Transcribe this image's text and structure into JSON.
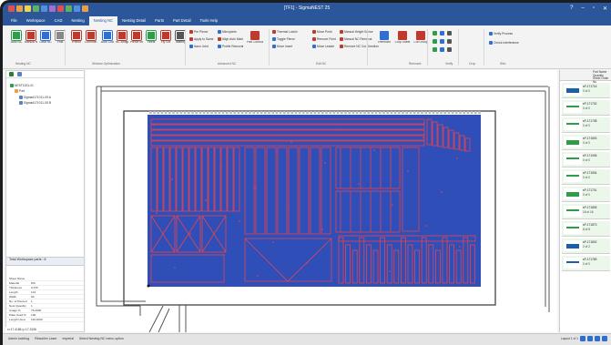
{
  "window": {
    "title": "[TF1] - SigmaNEST 25"
  },
  "tabs": [
    "File",
    "Workspace",
    "CAD",
    "Nesting",
    "Nesting NC",
    "Nesting Detail",
    "Parts",
    "Part Detail",
    "Tools Help"
  ],
  "active_tab": "Nesting NC",
  "ribbon": {
    "buttons": [
      {
        "label": "Auto NC"
      },
      {
        "label": "Manual NC"
      },
      {
        "label": "Clear NC"
      },
      {
        "label": "Post"
      },
      {
        "label": "iPierce"
      },
      {
        "label": "Common Cut"
      },
      {
        "label": "Auto Chain"
      },
      {
        "label": "NC Bridge"
      },
      {
        "label": "Pierce Move"
      },
      {
        "label": "Fillets"
      },
      {
        "label": "Fly Cut"
      },
      {
        "label": "Tabbing"
      }
    ],
    "small": [
      "Pre Pierce",
      "Apply to Same",
      "Nano Joint",
      "Microjoints",
      "Align Auto Mark",
      "Profile Removal",
      "Thermal Lockin",
      "Toggle Pierce",
      "Move Insert",
      "Move Point",
      "Remove Point",
      "Move Leader",
      "Manual Height Sense",
      "Manual NC Removal",
      "Remove NC Cut Direction",
      "Verify Process",
      "Check Interference"
    ],
    "big_right": [
      {
        "label": "Part Contour Loops"
      },
      {
        "label": "Remnant"
      },
      {
        "label": "Crop Sheet"
      },
      {
        "label": "Cut Group"
      }
    ],
    "groups": [
      "Nesting NC",
      "Window Optimization",
      "Advanced NC",
      "Edit NC",
      "Remnant",
      "Verify",
      "Crop",
      "Slim"
    ]
  },
  "left_panel": {
    "tree": [
      "NEST1001-01",
      "Part",
      "Sigma#171011-X5 A",
      "Sigma#171011-X5 B"
    ],
    "props_title": "Total Workspace parts : 6",
    "props": [
      {
        "k": "Sheet Name",
        "v": ""
      },
      {
        "k": "Material",
        "v": "MS"
      },
      {
        "k": "Thickness",
        "v": "0.375"
      },
      {
        "k": "Length",
        "v": "144"
      },
      {
        "k": "Width",
        "v": "60"
      },
      {
        "k": "No. of Pierced",
        "v": "1"
      },
      {
        "k": "Nest Quantity",
        "v": "1"
      },
      {
        "k": "Usage %",
        "v": "76.2000"
      },
      {
        "k": "Plate Used %",
        "v": "100"
      },
      {
        "k": "Length Used",
        "v": "116.4000"
      }
    ]
  },
  "right_panel": {
    "header": "Part Name Quantity Sheet Order Nu",
    "parts": [
      {
        "name": "sP-171716",
        "qty": "0 of 0",
        "color": "#1b5fa6"
      },
      {
        "name": "sP-171702",
        "qty": "0 of 0",
        "color": "#2e9d4a"
      },
      {
        "name": "sP-171708",
        "qty": "0 of 0",
        "color": "#2e9d4a"
      },
      {
        "name": "sP-171803",
        "qty": "0 of 0",
        "color": "#2e9d4a"
      },
      {
        "name": "sP-171006",
        "qty": "0 of 0",
        "color": "#2e9d4a"
      },
      {
        "name": "sP-171504",
        "qty": "0 of 0",
        "color": "#2e9d4a"
      },
      {
        "name": "sP-171701",
        "qty": "0 of 0",
        "color": "#2e9d4a"
      },
      {
        "name": "sP-171805",
        "qty": "16 of 16",
        "color": "#2e9d4a"
      },
      {
        "name": "sP-171873",
        "qty": "8 of 8",
        "color": "#2e9d4a"
      },
      {
        "name": "sP-171802",
        "qty": "2 of 2",
        "color": "#1b5fa6"
      },
      {
        "name": "sP-171789",
        "qty": "0 of 0",
        "color": "#1b5fa6"
      }
    ]
  },
  "status": {
    "coords": "x=17.4186 y=17.3196",
    "items": [
      "Admin lockfrog",
      "R#sublim Laser",
      "Imperial",
      "Select Nesting NC menu option"
    ],
    "page": "Layout 1 of 1"
  },
  "colors": {
    "accent": "#2b579a",
    "sheet": "#2f4eb8",
    "part_outline": "#e8444d"
  }
}
